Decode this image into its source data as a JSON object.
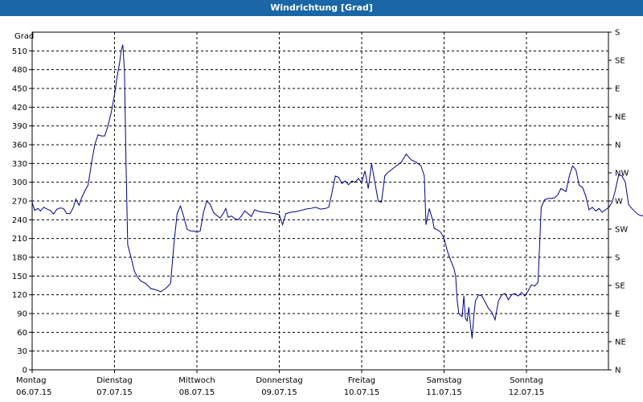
{
  "window": {
    "title": "Windrichtung [Grad]"
  },
  "chart_data": {
    "type": "line",
    "title": "Windrichtung [Grad]",
    "ylabel": "Grad",
    "ylim": [
      0,
      540
    ],
    "y_ticks": [
      0,
      30,
      60,
      90,
      120,
      150,
      180,
      210,
      240,
      270,
      300,
      330,
      360,
      390,
      420,
      450,
      480,
      510
    ],
    "right_axis_labels": [
      "S",
      "SE",
      "E",
      "NE",
      "N",
      "NW",
      "W",
      "SW",
      "S",
      "SE",
      "E",
      "NE",
      "N"
    ],
    "x_days": [
      {
        "day": "Montag",
        "date": "06.07.15"
      },
      {
        "day": "Dienstag",
        "date": "07.07.15"
      },
      {
        "day": "Mittwoch",
        "date": "08.07.15"
      },
      {
        "day": "Donnerstag",
        "date": "09.07.15"
      },
      {
        "day": "Freitag",
        "date": "10.07.15"
      },
      {
        "day": "Samstag",
        "date": "11.07.15"
      },
      {
        "day": "Sonntag",
        "date": "12.07.15"
      }
    ],
    "xlim": [
      0,
      7
    ],
    "grid": true,
    "series": [
      {
        "color": "#00008b",
        "points": [
          [
            0.0,
            268
          ],
          [
            0.03,
            255
          ],
          [
            0.07,
            258
          ],
          [
            0.1,
            254
          ],
          [
            0.14,
            260
          ],
          [
            0.18,
            257
          ],
          [
            0.22,
            255
          ],
          [
            0.26,
            249
          ],
          [
            0.3,
            257
          ],
          [
            0.34,
            259
          ],
          [
            0.38,
            258
          ],
          [
            0.42,
            250
          ],
          [
            0.46,
            250
          ],
          [
            0.5,
            260
          ],
          [
            0.53,
            273
          ],
          [
            0.57,
            263
          ],
          [
            0.6,
            275
          ],
          [
            0.64,
            286
          ],
          [
            0.68,
            296
          ],
          [
            0.72,
            330
          ],
          [
            0.76,
            360
          ],
          [
            0.8,
            376
          ],
          [
            0.84,
            374
          ],
          [
            0.88,
            374
          ],
          [
            0.92,
            390
          ],
          [
            0.96,
            412
          ],
          [
            1.0,
            440
          ],
          [
            1.03,
            468
          ],
          [
            1.06,
            490
          ],
          [
            1.08,
            510
          ],
          [
            1.1,
            520
          ],
          [
            1.12,
            480
          ],
          [
            1.14,
            330
          ],
          [
            1.16,
            200
          ],
          [
            1.2,
            180
          ],
          [
            1.24,
            158
          ],
          [
            1.28,
            148
          ],
          [
            1.32,
            142
          ],
          [
            1.38,
            138
          ],
          [
            1.44,
            130
          ],
          [
            1.5,
            128
          ],
          [
            1.56,
            125
          ],
          [
            1.62,
            130
          ],
          [
            1.68,
            138
          ],
          [
            1.72,
            200
          ],
          [
            1.76,
            250
          ],
          [
            1.8,
            262
          ],
          [
            1.84,
            245
          ],
          [
            1.88,
            225
          ],
          [
            1.92,
            222
          ],
          [
            1.96,
            222
          ],
          [
            2.0,
            220
          ],
          [
            2.04,
            222
          ],
          [
            2.08,
            252
          ],
          [
            2.12,
            270
          ],
          [
            2.16,
            265
          ],
          [
            2.2,
            252
          ],
          [
            2.24,
            247
          ],
          [
            2.28,
            243
          ],
          [
            2.32,
            250
          ],
          [
            2.35,
            258
          ],
          [
            2.38,
            244
          ],
          [
            2.42,
            246
          ],
          [
            2.46,
            242
          ],
          [
            2.5,
            240
          ],
          [
            2.54,
            246
          ],
          [
            2.58,
            254
          ],
          [
            2.62,
            250
          ],
          [
            2.66,
            245
          ],
          [
            2.7,
            256
          ],
          [
            2.76,
            253
          ],
          [
            2.82,
            252
          ],
          [
            2.88,
            251
          ],
          [
            2.94,
            250
          ],
          [
            3.0,
            248
          ],
          [
            3.04,
            232
          ],
          [
            3.08,
            250
          ],
          [
            3.14,
            252
          ],
          [
            3.2,
            253
          ],
          [
            3.26,
            255
          ],
          [
            3.32,
            257
          ],
          [
            3.38,
            258
          ],
          [
            3.44,
            260
          ],
          [
            3.5,
            257
          ],
          [
            3.56,
            258
          ],
          [
            3.6,
            260
          ],
          [
            3.64,
            284
          ],
          [
            3.68,
            310
          ],
          [
            3.72,
            308
          ],
          [
            3.76,
            298
          ],
          [
            3.8,
            302
          ],
          [
            3.84,
            296
          ],
          [
            3.88,
            302
          ],
          [
            3.92,
            300
          ],
          [
            3.96,
            306
          ],
          [
            4.0,
            300
          ],
          [
            4.04,
            318
          ],
          [
            4.08,
            290
          ],
          [
            4.12,
            330
          ],
          [
            4.16,
            300
          ],
          [
            4.2,
            270
          ],
          [
            4.24,
            268
          ],
          [
            4.28,
            310
          ],
          [
            4.32,
            316
          ],
          [
            4.36,
            320
          ],
          [
            4.42,
            326
          ],
          [
            4.48,
            332
          ],
          [
            4.54,
            345
          ],
          [
            4.6,
            336
          ],
          [
            4.66,
            332
          ],
          [
            4.72,
            326
          ],
          [
            4.76,
            310
          ],
          [
            4.78,
            232
          ],
          [
            4.82,
            258
          ],
          [
            4.86,
            240
          ],
          [
            4.88,
            226
          ],
          [
            4.92,
            224
          ],
          [
            4.96,
            220
          ],
          [
            5.0,
            210
          ],
          [
            5.04,
            190
          ],
          [
            5.08,
            175
          ],
          [
            5.12,
            162
          ],
          [
            5.14,
            150
          ],
          [
            5.16,
            110
          ],
          [
            5.18,
            90
          ],
          [
            5.22,
            85
          ],
          [
            5.24,
            118
          ],
          [
            5.26,
            82
          ],
          [
            5.28,
            78
          ],
          [
            5.3,
            100
          ],
          [
            5.32,
            72
          ],
          [
            5.34,
            50
          ],
          [
            5.36,
            85
          ],
          [
            5.38,
            110
          ],
          [
            5.42,
            120
          ],
          [
            5.46,
            118
          ],
          [
            5.5,
            108
          ],
          [
            5.54,
            98
          ],
          [
            5.58,
            92
          ],
          [
            5.62,
            80
          ],
          [
            5.66,
            110
          ],
          [
            5.7,
            120
          ],
          [
            5.74,
            122
          ],
          [
            5.78,
            112
          ],
          [
            5.82,
            120
          ],
          [
            5.86,
            122
          ],
          [
            5.9,
            118
          ],
          [
            5.94,
            124
          ],
          [
            5.98,
            118
          ],
          [
            6.02,
            126
          ],
          [
            6.06,
            136
          ],
          [
            6.1,
            134
          ],
          [
            6.14,
            140
          ],
          [
            6.16,
            200
          ],
          [
            6.18,
            260
          ],
          [
            6.22,
            272
          ],
          [
            6.26,
            274
          ],
          [
            6.3,
            274
          ],
          [
            6.34,
            275
          ],
          [
            6.38,
            280
          ],
          [
            6.42,
            290
          ],
          [
            6.48,
            285
          ],
          [
            6.52,
            310
          ],
          [
            6.56,
            326
          ],
          [
            6.6,
            320
          ],
          [
            6.64,
            295
          ],
          [
            6.68,
            292
          ],
          [
            6.72,
            278
          ],
          [
            6.76,
            256
          ],
          [
            6.8,
            260
          ],
          [
            6.84,
            254
          ],
          [
            6.88,
            258
          ],
          [
            6.92,
            252
          ],
          [
            6.96,
            256
          ],
          [
            7.0,
            260
          ],
          [
            7.04,
            268
          ],
          [
            7.08,
            288
          ],
          [
            7.12,
            312
          ],
          [
            7.16,
            310
          ],
          [
            7.2,
            300
          ],
          [
            7.24,
            264
          ],
          [
            7.3,
            255
          ],
          [
            7.36,
            248
          ],
          [
            7.42,
            246
          ],
          [
            7.48,
            240
          ],
          [
            7.52,
            250
          ],
          [
            7.56,
            242
          ],
          [
            7.6,
            245
          ]
        ]
      }
    ]
  }
}
